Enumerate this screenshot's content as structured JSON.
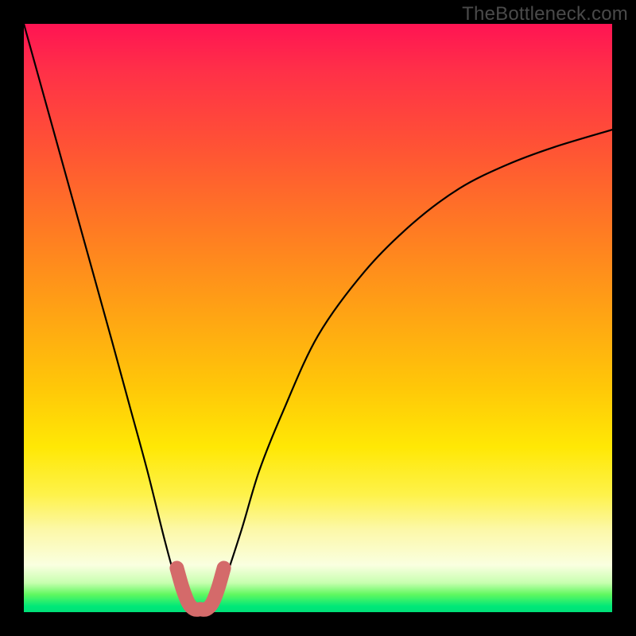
{
  "watermark": "TheBottleneck.com",
  "chart_data": {
    "type": "line",
    "title": "",
    "xlabel": "",
    "ylabel": "",
    "xlim": [
      0,
      100
    ],
    "ylim": [
      0,
      100
    ],
    "grid": false,
    "series": [
      {
        "name": "bottleneck-curve",
        "x": [
          0,
          5,
          10,
          15,
          18,
          21,
          24,
          26,
          28,
          29,
          30,
          31,
          32,
          34,
          37,
          40,
          44,
          50,
          58,
          66,
          74,
          82,
          90,
          100
        ],
        "values": [
          100,
          82,
          64,
          46,
          35,
          24,
          12,
          5,
          1,
          0,
          0,
          0,
          1,
          5,
          14,
          24,
          34,
          47,
          58,
          66,
          72,
          76,
          79,
          82
        ]
      },
      {
        "name": "optimal-marker",
        "x": [
          26,
          27,
          28,
          29,
          30,
          31,
          32,
          33,
          34
        ],
        "values": [
          7.5,
          4,
          1.5,
          0.5,
          0.5,
          0.5,
          1.5,
          4,
          7.5
        ]
      }
    ],
    "annotations": []
  },
  "colors": {
    "curve": "#000000",
    "marker": "#d46a6a",
    "background_top": "#ff1453",
    "background_bottom": "#00e078"
  }
}
